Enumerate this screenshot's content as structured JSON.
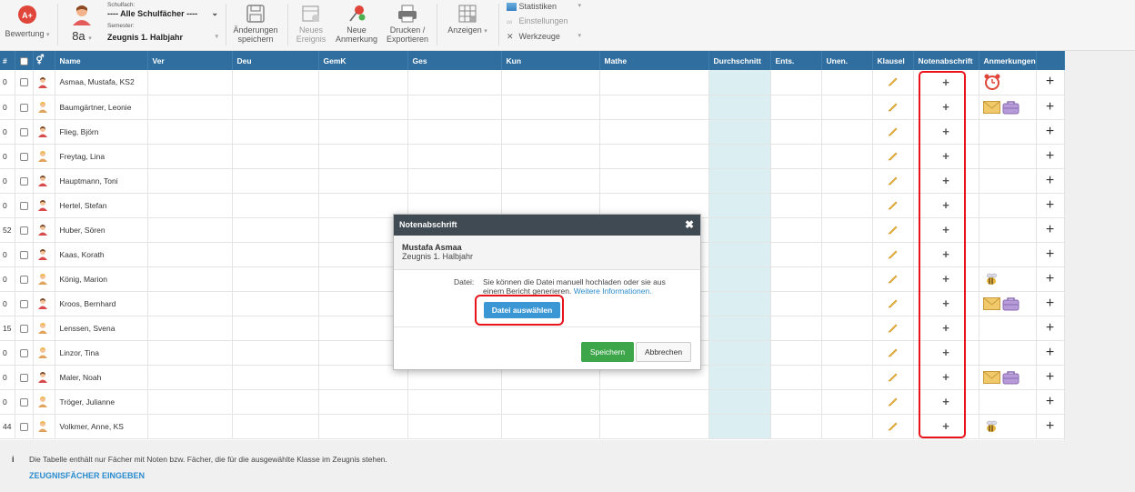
{
  "toolbar": {
    "bewertung_label": "Bewertung",
    "class_label": "8a",
    "schulfach_caption": "Schulfach:",
    "schulfach_value": "---- Alle Schulfächer ----",
    "semester_caption": "Semester:",
    "semester_value": "Zeugnis 1. Halbjahr",
    "save_label_1": "Änderungen",
    "save_label_2": "speichern",
    "event_label_1": "Neues",
    "event_label_2": "Ereignis",
    "note_label_1": "Neue",
    "note_label_2": "Anmerkung",
    "print_label_1": "Drucken /",
    "print_label_2": "Exportieren",
    "view_label": "Anzeigen",
    "stats_label": "Statistiken",
    "settings_label": "Einstellungen",
    "tools_label": "Werkzeuge"
  },
  "table": {
    "headers": [
      "#",
      "",
      "",
      "Name",
      "Ver",
      "Deu",
      "GemK",
      "Ges",
      "Kun",
      "Mathe",
      "Durchschnitt",
      "Ents.",
      "Unen.",
      "Klausel",
      "Notenabschrift",
      "Anmerkungen",
      ""
    ],
    "rows": [
      {
        "num": "0",
        "name": "Asmaa, Mustafa, KS2",
        "gender": "m",
        "notes": [
          "clock"
        ]
      },
      {
        "num": "0",
        "name": "Baumgärtner, Leonie",
        "gender": "f",
        "notes": [
          "mail",
          "bag"
        ]
      },
      {
        "num": "0",
        "name": "Flieg, Björn",
        "gender": "m",
        "notes": []
      },
      {
        "num": "0",
        "name": "Freytag, Lina",
        "gender": "f",
        "notes": []
      },
      {
        "num": "0",
        "name": "Hauptmann, Toni",
        "gender": "m",
        "notes": []
      },
      {
        "num": "0",
        "name": "Hertel, Stefan",
        "gender": "m",
        "notes": []
      },
      {
        "num": "52",
        "name": "Huber, Sören",
        "gender": "m",
        "notes": []
      },
      {
        "num": "0",
        "name": "Kaas, Korath",
        "gender": "m",
        "notes": []
      },
      {
        "num": "0",
        "name": "König, Marion",
        "gender": "f",
        "notes": [
          "bee"
        ]
      },
      {
        "num": "0",
        "name": "Kroos, Bernhard",
        "gender": "m",
        "notes": [
          "mail",
          "bag"
        ]
      },
      {
        "num": "15",
        "name": "Lenssen, Svena",
        "gender": "f",
        "notes": []
      },
      {
        "num": "0",
        "name": "Linzor, Tina",
        "gender": "f",
        "notes": []
      },
      {
        "num": "0",
        "name": "Maler, Noah",
        "gender": "m",
        "notes": [
          "mail",
          "bag"
        ]
      },
      {
        "num": "0",
        "name": "Tröger, Julianne",
        "gender": "f",
        "notes": []
      },
      {
        "num": "44",
        "name": "Volkmer, Anne, KS",
        "gender": "f",
        "notes": [
          "bee"
        ]
      }
    ]
  },
  "footer": {
    "info_text": "Die Tabelle enthält nur Fächer mit Noten bzw. Fächer, die für die ausgewählte Klasse im Zeugnis stehen.",
    "link_text": "ZEUGNISFÄCHER EINGEBEN"
  },
  "modal": {
    "title": "Notenabschrift",
    "close_glyph": "✖",
    "student_name": "Mustafa Asmaa",
    "semester": "Zeugnis 1. Halbjahr",
    "file_label": "Datei:",
    "file_hint_1": "Sie können die Datei manuell hochladen oder sie aus",
    "file_hint_2": "einem Bericht generieren.",
    "more_info_link": "Weitere Informationen.",
    "choose_file_button": "Datei auswählen",
    "save_button": "Speichern",
    "cancel_button": "Abbrechen"
  },
  "colors": {
    "header_bg": "#2f6e9f",
    "average_col_bg": "#dbeef2",
    "highlight_red": "#e8141a",
    "primary_blue": "#3a97d4",
    "save_green": "#3da64a"
  }
}
